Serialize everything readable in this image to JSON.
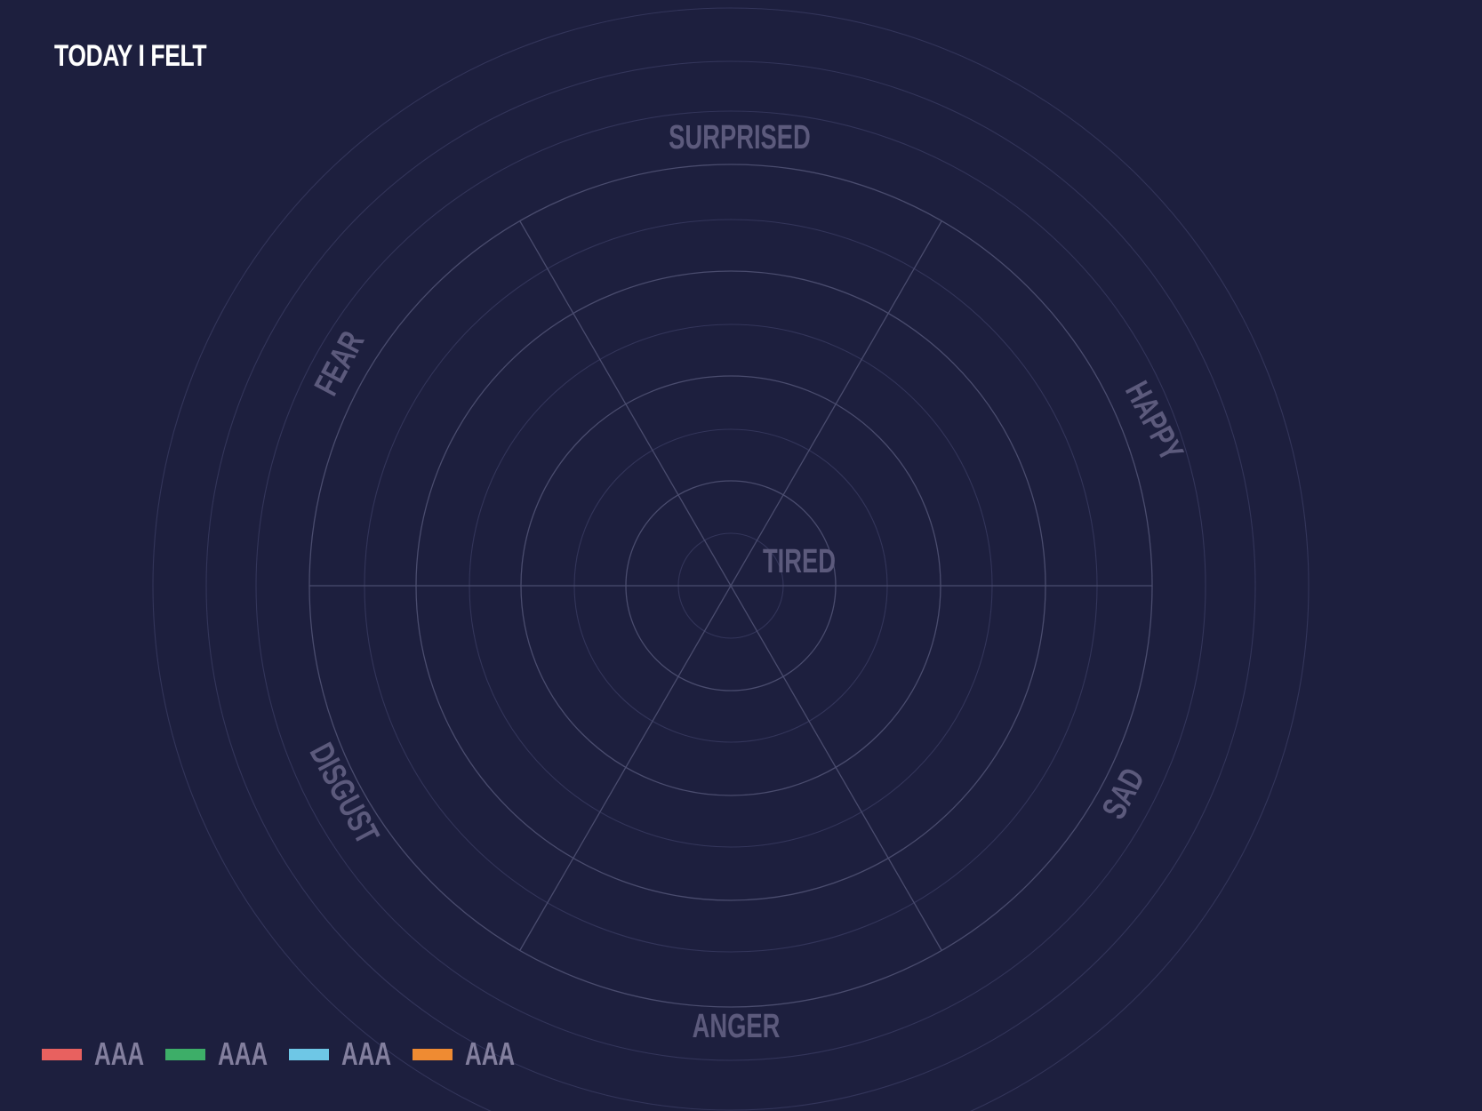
{
  "title": "TODAY I FELT",
  "chart_data": {
    "type": "radial",
    "categories": [
      "SURPRISED",
      "HAPPY",
      "SAD",
      "ANGER",
      "DISGUST",
      "FEAR",
      "TIRED"
    ],
    "series": [],
    "legend": {
      "placement": "bottom-left",
      "items": [
        {
          "label": "AAA",
          "color": "#e8615f"
        },
        {
          "label": "AAA",
          "color": "#3dae68"
        },
        {
          "label": "AAA",
          "color": "#6ec7e6"
        },
        {
          "label": "AAA",
          "color": "#ef8b32"
        }
      ]
    },
    "grid": true
  },
  "colors": {
    "background": "#1d1f3e",
    "grid_major": "#4a4c6e",
    "grid_minor": "#33355a",
    "label": "#5c5a7c"
  }
}
